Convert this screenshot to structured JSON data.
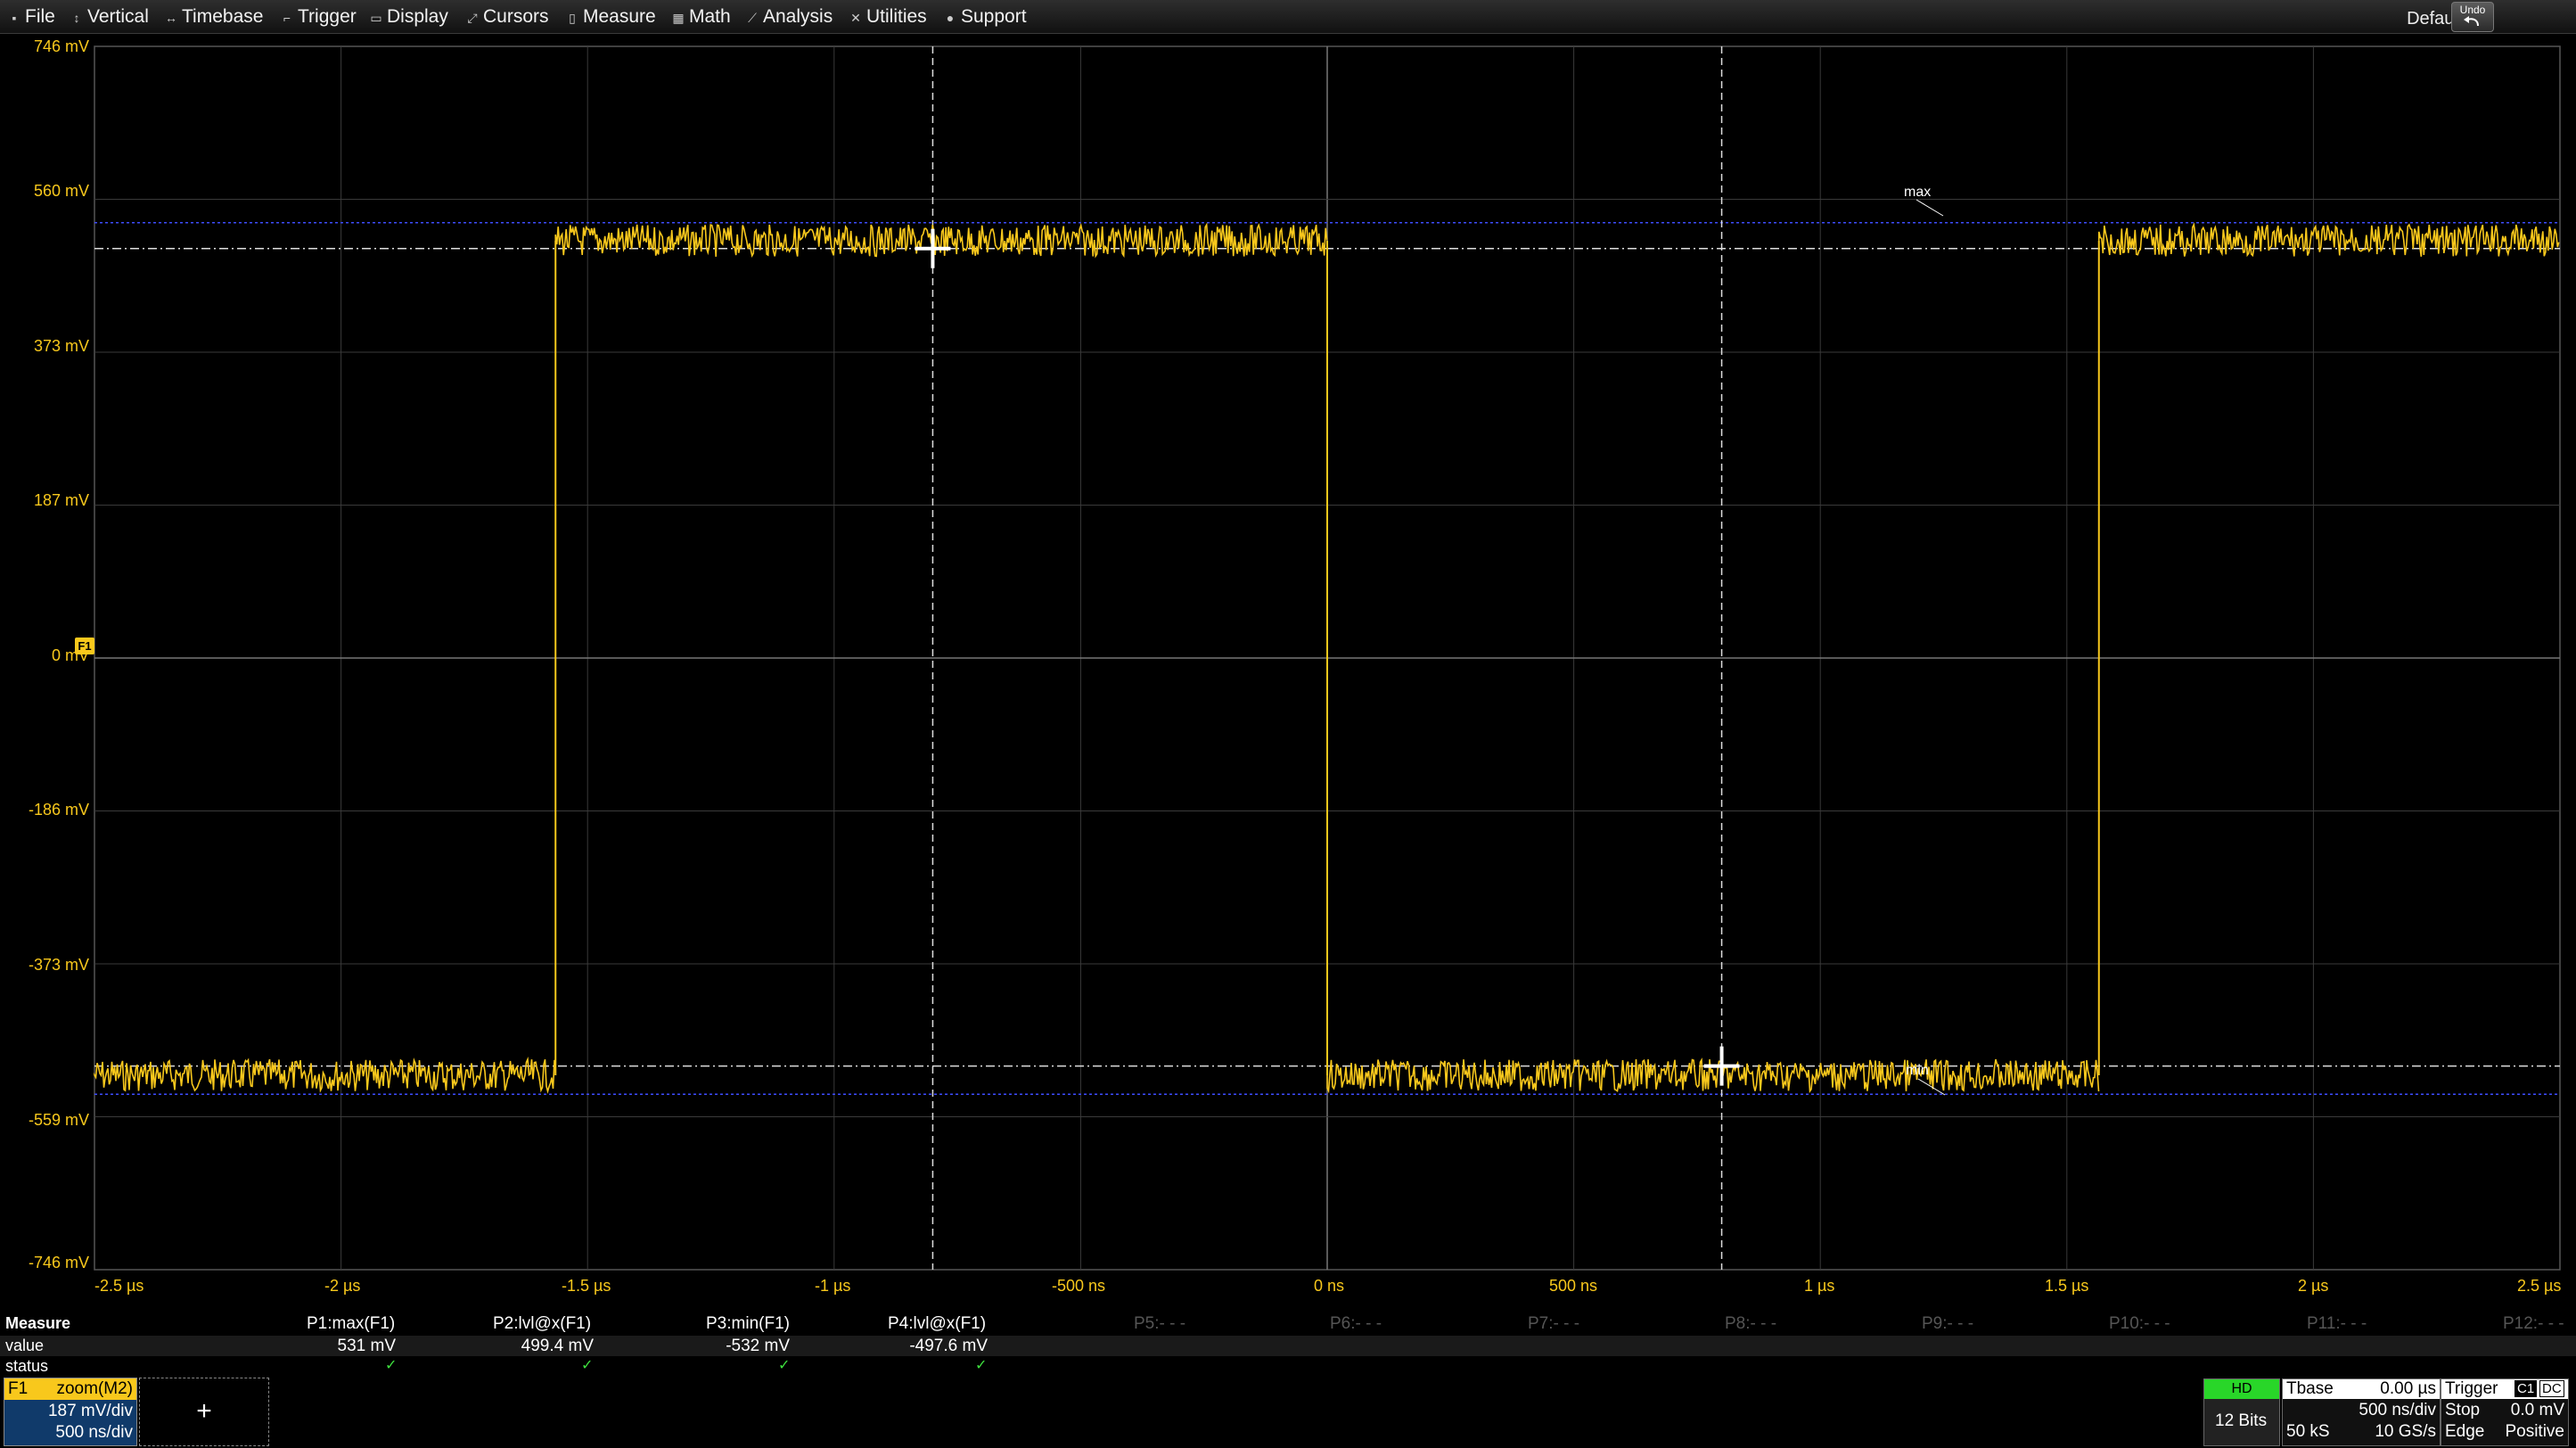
{
  "menu": {
    "items": [
      {
        "label": "File",
        "icon": "file-icon"
      },
      {
        "label": "Vertical",
        "icon": "vertical-icon"
      },
      {
        "label": "Timebase",
        "icon": "timebase-icon"
      },
      {
        "label": "Trigger",
        "icon": "trigger-icon"
      },
      {
        "label": "Display",
        "icon": "display-icon"
      },
      {
        "label": "Cursors",
        "icon": "cursors-icon"
      },
      {
        "label": "Measure",
        "icon": "measure-icon"
      },
      {
        "label": "Math",
        "icon": "math-icon"
      },
      {
        "label": "Analysis",
        "icon": "analysis-icon"
      },
      {
        "label": "Utilities",
        "icon": "utilities-icon"
      },
      {
        "label": "Support",
        "icon": "support-icon"
      }
    ],
    "default_label": "Default:",
    "undo_label": "Undo"
  },
  "scope": {
    "y_labels": [
      "746 mV",
      "560 mV",
      "373 mV",
      "187 mV",
      "0 mV",
      "-186 mV",
      "-373 mV",
      "-559 mV",
      "-746 mV"
    ],
    "x_labels": [
      "-2.5 µs",
      "-2 µs",
      "-1.5 µs",
      "-1 µs",
      "-500 ns",
      "0 ns",
      "500 ns",
      "1 µs",
      "1.5 µs",
      "2 µs",
      "2.5 µs"
    ],
    "trace_marker": "F1",
    "max_label": "max",
    "min_label": "min",
    "trace_color": "#f8c81c",
    "grid_color": "#3a3a3a"
  },
  "chart_data": {
    "type": "line",
    "x_unit": "µs",
    "y_unit": "mV",
    "xlim": [
      -2.5,
      2.5
    ],
    "ylim": [
      -746,
      746
    ],
    "series": [
      {
        "x": [
          -2.5,
          -1.565,
          -1.565,
          0.0,
          0.0,
          1.565,
          1.565,
          2.5
        ],
        "y": [
          -509,
          -509,
          509,
          509,
          -509,
          -509,
          509,
          509
        ]
      }
    ],
    "horizontal_cursors_mV": [
      499.4,
      -497.6
    ],
    "vertical_cursors_us": [
      -0.8,
      0.8
    ],
    "max_line_mV": 531,
    "min_line_mV": -532
  },
  "measure": {
    "header_label": "Measure",
    "value_label": "value",
    "status_label": "status",
    "params": [
      {
        "name": "P1:max(F1)",
        "value": "531 mV",
        "ok": "✓"
      },
      {
        "name": "P2:lvl@x(F1)",
        "value": "499.4 mV",
        "ok": "✓"
      },
      {
        "name": "P3:min(F1)",
        "value": "-532 mV",
        "ok": "✓"
      },
      {
        "name": "P4:lvl@x(F1)",
        "value": "-497.6 mV",
        "ok": "✓"
      }
    ],
    "empty_params": [
      "P5:- - -",
      "P6:- - -",
      "P7:- - -",
      "P8:- - -",
      "P9:- - -",
      "P10:- - -",
      "P11:- - -",
      "P12:- - -"
    ]
  },
  "f1": {
    "name": "F1",
    "source": "zoom(M2)",
    "vdiv": "187 mV/div",
    "tdiv": "500 ns/div",
    "add": "+"
  },
  "status": {
    "hd": "HD",
    "bits": "12 Bits",
    "tbase_label": "Tbase",
    "tbase_value": "0.00 µs",
    "tdiv": "500 ns/div",
    "samples": "50 kS",
    "rate": "10 GS/s",
    "trigger_label": "Trigger",
    "trigger_ch": "C1",
    "trigger_coupling": "DC",
    "mode": "Stop",
    "level": "0.0 mV",
    "type": "Edge",
    "slope": "Positive"
  }
}
